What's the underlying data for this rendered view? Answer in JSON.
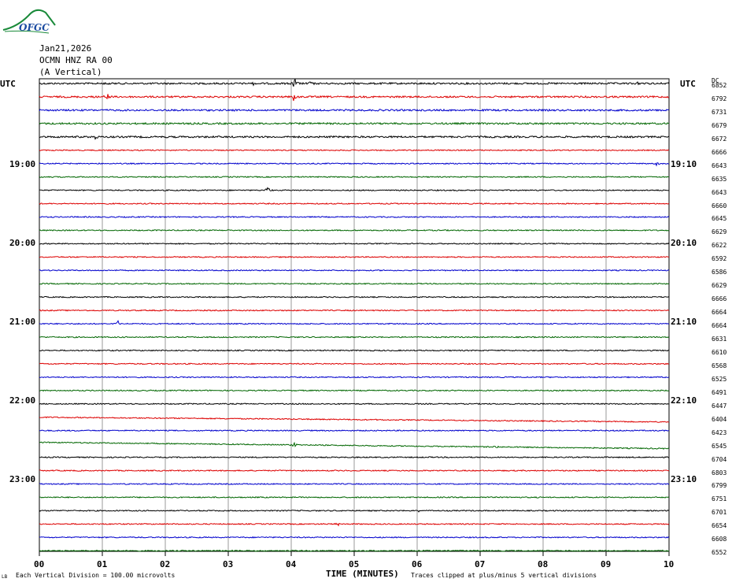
{
  "logo": {
    "text": "OFGC",
    "color": "#1a8a3a"
  },
  "header": {
    "date": "Jan21,2026",
    "station": "OCMN HNZ RA 00",
    "component": "(A Vertical)"
  },
  "left_axis_label": "UTC",
  "right_axis_label": "UTC",
  "dc_header": "DC",
  "left_time_labels": [
    "19:00",
    "20:00",
    "21:00",
    "22:00",
    "23:00"
  ],
  "right_time_labels": [
    "19:10",
    "20:10",
    "21:10",
    "22:10",
    "23:10"
  ],
  "footer": {
    "left_note": "Each Vertical Division =  100.00 microvolts",
    "right_note": "Traces clipped at plus/minus 5 vertical divisions",
    "small_mark": "LB"
  },
  "chart_data": {
    "type": "line",
    "xlabel": "TIME (MINUTES)",
    "xlim": [
      0,
      10
    ],
    "x_ticks": [
      "00",
      "01",
      "02",
      "03",
      "04",
      "05",
      "06",
      "07",
      "08",
      "09",
      "10"
    ],
    "trace_colors": [
      "#000000",
      "#dd0000",
      "#0000cc",
      "#006600"
    ],
    "trace_count": 36,
    "dc_offsets": [
      6852,
      6792,
      6731,
      6679,
      6672,
      6666,
      6643,
      6635,
      6643,
      6660,
      6645,
      6629,
      6622,
      6592,
      6586,
      6629,
      6666,
      6664,
      6664,
      6631,
      6610,
      6568,
      6525,
      6491,
      6447,
      6404,
      6423,
      6545,
      6704,
      6803,
      6799,
      6751,
      6701,
      6654,
      6608,
      6552
    ],
    "events": [
      {
        "trace": 0,
        "minute": 4.05,
        "amplitude": 9
      },
      {
        "trace": 0,
        "minute": 4.3,
        "amplitude": 4
      },
      {
        "trace": 0,
        "minute": 1.1,
        "amplitude": 2
      },
      {
        "trace": 0,
        "minute": 3.4,
        "amplitude": 2
      },
      {
        "trace": 0,
        "minute": 9.5,
        "amplitude": 2
      },
      {
        "trace": 1,
        "minute": 1.08,
        "amplitude": 6
      },
      {
        "trace": 1,
        "minute": 4.05,
        "amplitude": 8
      },
      {
        "trace": 3,
        "minute": 2.3,
        "amplitude": 2
      },
      {
        "trace": 4,
        "minute": 0.9,
        "amplitude": 3
      },
      {
        "trace": 6,
        "minute": 9.8,
        "amplitude": 3
      },
      {
        "trace": 8,
        "minute": 3.63,
        "amplitude": 6
      },
      {
        "trace": 18,
        "minute": 1.25,
        "amplitude": 4
      },
      {
        "trace": 27,
        "minute": 4.05,
        "amplitude": 4
      },
      {
        "trace": 27,
        "minute": 7.25,
        "amplitude": 3
      },
      {
        "trace": 32,
        "minute": 6.05,
        "amplitude": 3
      },
      {
        "trace": 33,
        "minute": 4.75,
        "amplitude": 3
      }
    ],
    "drifts": [
      {
        "trace": 25,
        "start": 0,
        "end": 6
      },
      {
        "trace": 27,
        "start": -2,
        "end": 6
      }
    ]
  }
}
